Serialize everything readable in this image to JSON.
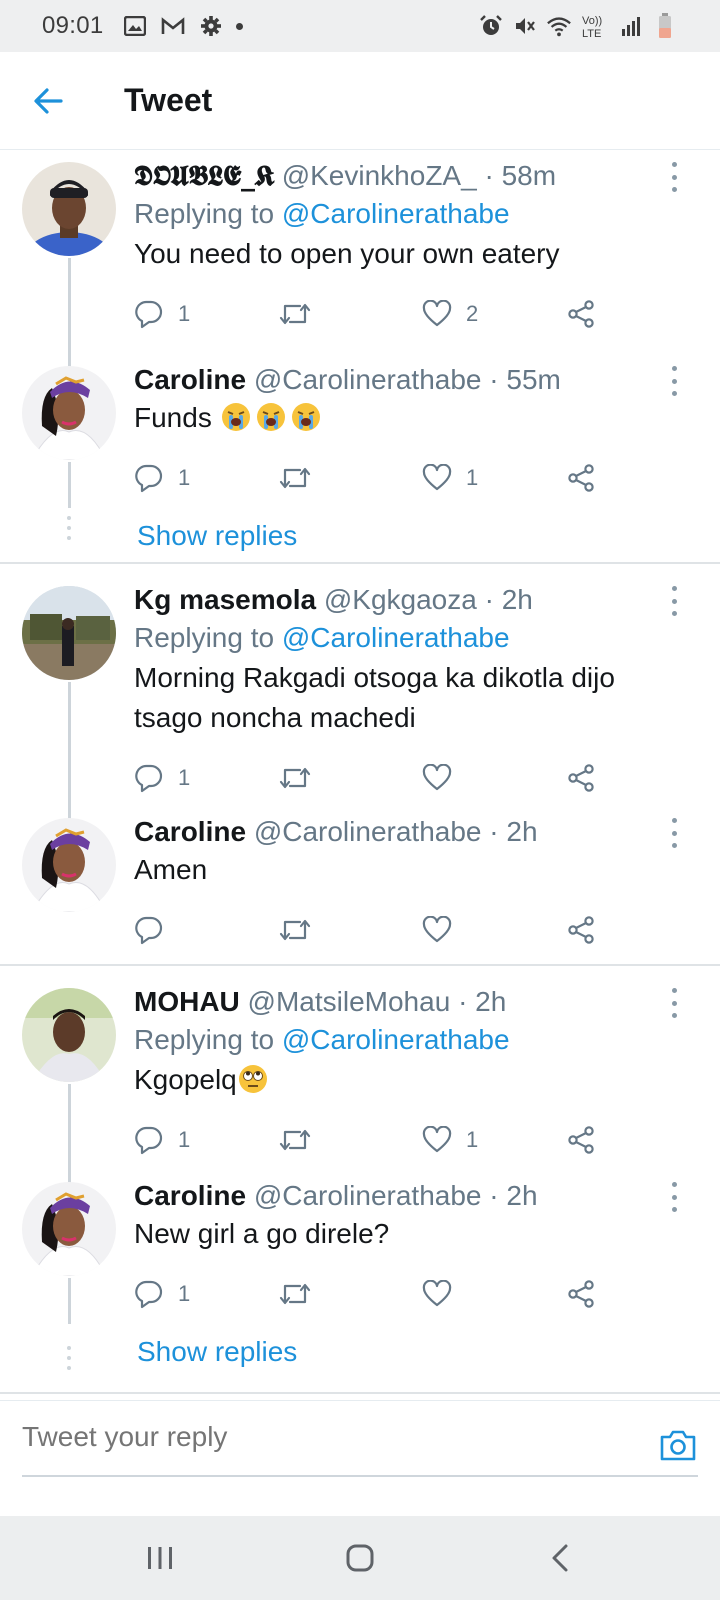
{
  "status_bar": {
    "time": "09:01",
    "left_icons": [
      "image-icon",
      "gmail-icon",
      "settings-icon",
      "dot-icon"
    ],
    "right_icons": [
      "alarm-icon",
      "mute-icon",
      "wifi-icon",
      "volte-icon",
      "signal-icon",
      "battery-icon"
    ],
    "volte_label": "Vo)) LTE"
  },
  "header": {
    "title": "Tweet"
  },
  "threads": [
    {
      "tweets": [
        {
          "name": "𝕯𝕺𝖀𝕭𝕷𝕰_𝕶",
          "handle": "@KevinkhoZA_",
          "time": "58m",
          "replying_label": "Replying to",
          "replying_to": "@Carolinerathabe",
          "text": "You need to open your own eatery",
          "replies": "1",
          "likes": "2"
        },
        {
          "name": "Caroline",
          "handle": "@Carolinerathabe",
          "time": "55m",
          "text": "Funds",
          "emoji": [
            "loudly-crying-face",
            "loudly-crying-face",
            "loudly-crying-face"
          ],
          "replies": "1",
          "likes": "1"
        }
      ],
      "show_replies": "Show replies"
    },
    {
      "tweets": [
        {
          "name": "Kg masemola",
          "handle": "@Kgkgaoza",
          "time": "2h",
          "replying_label": "Replying to",
          "replying_to": "@Carolinerathabe",
          "text_line1": "Morning Rakgadi otsoga ka dikotla dijo",
          "text_line2": "tsago noncha machedi",
          "replies": "1",
          "likes": ""
        },
        {
          "name": "Caroline",
          "handle": "@Carolinerathabe",
          "time": "2h",
          "text": "Amen",
          "replies": "",
          "likes": ""
        }
      ]
    },
    {
      "tweets": [
        {
          "name": "MOHAU",
          "handle": "@MatsileMohau",
          "time": "2h",
          "replying_label": "Replying to",
          "replying_to": "@Carolinerathabe",
          "text": "Kgopelq",
          "emoji": [
            "face-with-rolling-eyes"
          ],
          "replies": "1",
          "likes": "1"
        },
        {
          "name": "Caroline",
          "handle": "@Carolinerathabe",
          "time": "2h",
          "text": "New girl a go direle?",
          "replies": "1",
          "likes": ""
        }
      ],
      "show_replies": "Show replies"
    }
  ],
  "composer": {
    "placeholder": "Tweet your reply"
  },
  "colors": {
    "accent": "#1d91da",
    "secondary_text": "#657786",
    "divider": "#dfe3e6"
  }
}
